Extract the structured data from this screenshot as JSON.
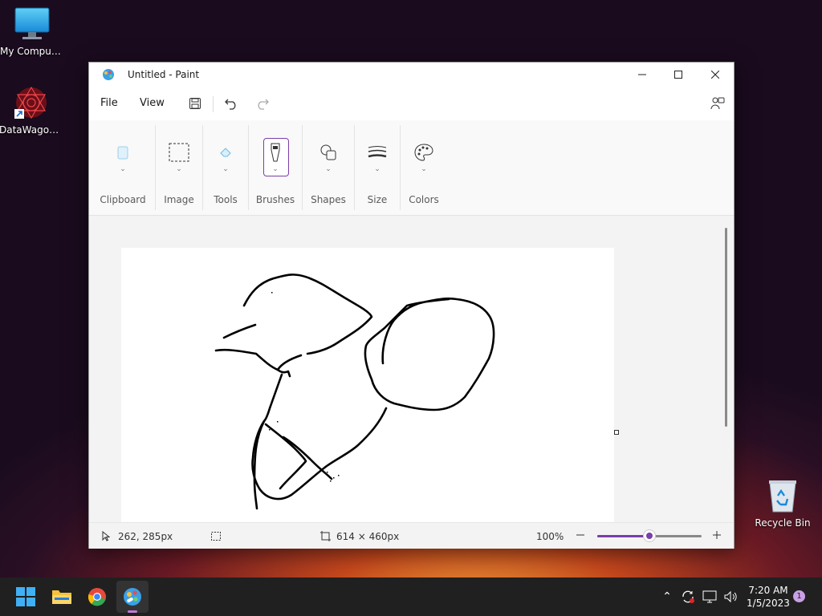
{
  "desktop": {
    "icons": [
      {
        "label": "My Computer",
        "icon": "monitor-icon"
      },
      {
        "label": "DataWagon...",
        "icon": "datawagon-shortcut-icon"
      },
      {
        "label": "Recycle Bin",
        "icon": "recycle-bin-icon"
      }
    ]
  },
  "window": {
    "title": "Untitled - Paint",
    "menu": {
      "file": "File",
      "view": "View"
    },
    "ribbon": {
      "groups": [
        "Clipboard",
        "Image",
        "Tools",
        "Brushes",
        "Shapes",
        "Size",
        "Colors"
      ]
    },
    "status": {
      "cursor_pos": "262, 285px",
      "canvas_size": "614 × 460px",
      "zoom": "100%",
      "zoom_level": 0.5
    },
    "accent_color": "#7a3fa8"
  },
  "taskbar": {
    "apps": [
      "start-button",
      "file-explorer",
      "chrome",
      "paint"
    ],
    "time": "7:20 AM",
    "date": "1/5/2023",
    "notification_count": "1"
  }
}
